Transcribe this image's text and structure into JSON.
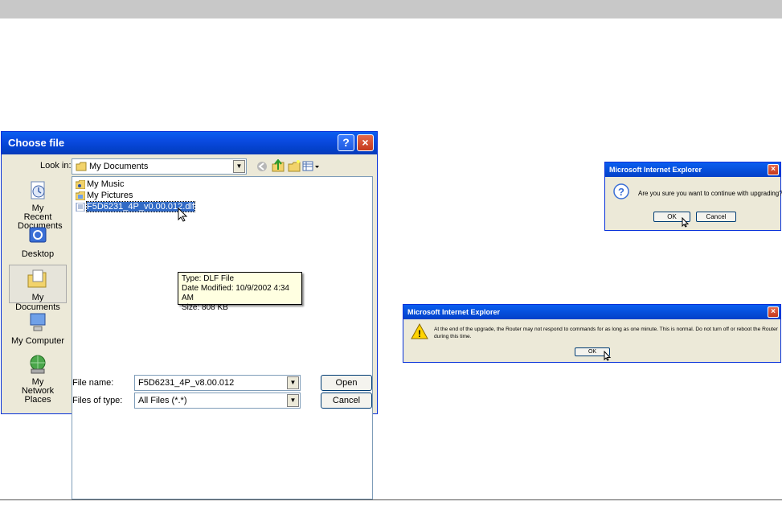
{
  "choose_file": {
    "title": "Choose file",
    "look_in_label": "Look in:",
    "look_in_value": "My Documents",
    "places": [
      "My Recent Documents",
      "Desktop",
      "My Documents",
      "My Computer",
      "My Network Places"
    ],
    "files": [
      "My Music",
      "My Pictures",
      "F5D6231_4P_v0.00.012.dlf"
    ],
    "tooltip": {
      "type": "Type: DLF File",
      "modified": "Date Modified: 10/9/2002 4:34 AM",
      "size": "Size: 808 KB"
    },
    "file_name_label": "File name:",
    "file_name_value": "F5D6231_4P_v8.00.012",
    "files_of_type_label": "Files of type:",
    "files_of_type_value": "All Files (*.*)",
    "open_label": "Open",
    "cancel_label": "Cancel",
    "help_glyph": "?",
    "close_glyph": "×"
  },
  "confirm_dialog": {
    "title": "Microsoft Internet Explorer",
    "message": "Are you sure you want to continue with upgrading?",
    "ok_label": "OK",
    "cancel_label": "Cancel"
  },
  "warning_dialog": {
    "title": "Microsoft Internet Explorer",
    "message_line1": "At the end of the upgrade, the Router may not respond to commands for as long as one minute. This is normal. Do not turn off or reboot the Router",
    "message_line2": "during this time.",
    "ok_label": "OK"
  },
  "colors": {
    "xp_blue": "#0a4ae0",
    "selection": "#316ac5",
    "tooltip_bg": "#ffffe1"
  }
}
